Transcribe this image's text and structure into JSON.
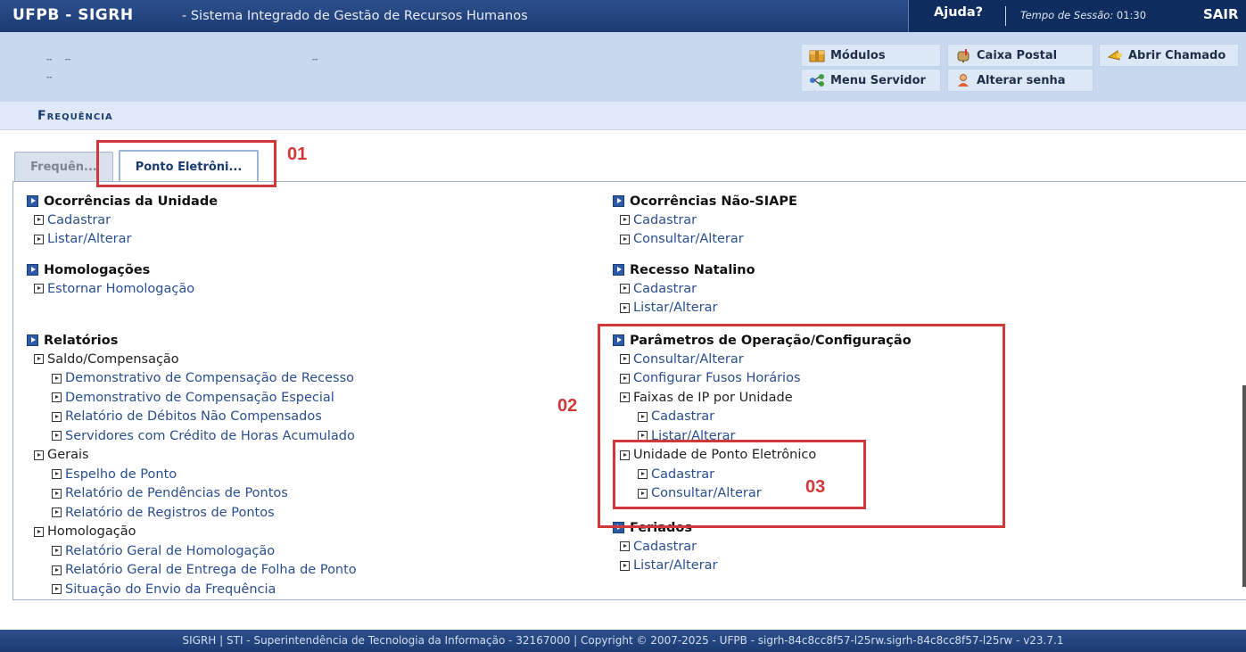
{
  "header": {
    "system": "UFPB - SIGRH",
    "system_name": "- Sistema Integrado de Gestão de Recursos Humanos",
    "help": "Ajuda?",
    "session_label": "Tempo de Sessão:",
    "session_time": "01:30",
    "logout": "SAIR"
  },
  "menu": {
    "modules": "Módulos",
    "mailbox": "Caixa Postal",
    "open_ticket": "Abrir Chamado",
    "server_menu": "Menu Servidor",
    "change_password": "Alterar senha"
  },
  "section": {
    "title": "Frequência"
  },
  "tabs": [
    {
      "label": "Frequên..."
    },
    {
      "label": "Ponto Eletrôni..."
    }
  ],
  "left_column": {
    "ocorrencias": {
      "title": "Ocorrências da Unidade",
      "items": [
        "Cadastrar",
        "Listar/Alterar"
      ]
    },
    "homologacoes": {
      "title": "Homologações",
      "items": [
        "Estornar Homologação"
      ]
    },
    "relatorios": {
      "title": "Relatórios",
      "saldo": "Saldo/Compensação",
      "saldo_items": [
        "Demonstrativo de Compensação de Recesso",
        "Demonstrativo de Compensação Especial",
        "Relatório de Débitos Não Compensados",
        "Servidores com Crédito de Horas Acumulado"
      ],
      "gerais": "Gerais",
      "gerais_items": [
        "Espelho de Ponto",
        "Relatório de Pendências de Pontos",
        "Relatório de Registros de Pontos"
      ],
      "homologacao": "Homologação",
      "homologacao_items": [
        "Relatório Geral de Homologação",
        "Relatório Geral de Entrega de Folha de Ponto",
        "Situação do Envio da Frequência"
      ]
    }
  },
  "right_column": {
    "nao_siape": {
      "title": "Ocorrências Não-SIAPE",
      "items": [
        "Cadastrar",
        "Consultar/Alterar"
      ]
    },
    "recesso": {
      "title": "Recesso Natalino",
      "items": [
        "Cadastrar",
        "Listar/Alterar"
      ]
    },
    "parametros": {
      "title": "Parâmetros de Operação/Configuração",
      "items": [
        "Consultar/Alterar",
        "Configurar Fusos Horários"
      ],
      "faixas": "Faixas de IP por Unidade",
      "faixas_items": [
        "Cadastrar",
        "Listar/Alterar"
      ],
      "unidade": "Unidade de Ponto Eletrônico",
      "unidade_items": [
        "Cadastrar",
        "Consultar/Alterar"
      ]
    },
    "feriados": {
      "title": "Feriados",
      "items": [
        "Cadastrar",
        "Listar/Alterar"
      ]
    }
  },
  "annotations": {
    "a1": "01",
    "a2": "02",
    "a3": "03"
  },
  "footer": {
    "text": "SIGRH | STI - Superintendência de Tecnologia da Informação - 32167000 | Copyright © 2007-2025 - UFPB - sigrh-84c8cc8f57-l25rw.sigrh-84c8cc8f57-l25rw - v23.7.1"
  },
  "colors": {
    "accent": "#1b3b73",
    "annotation": "#d0383a"
  }
}
